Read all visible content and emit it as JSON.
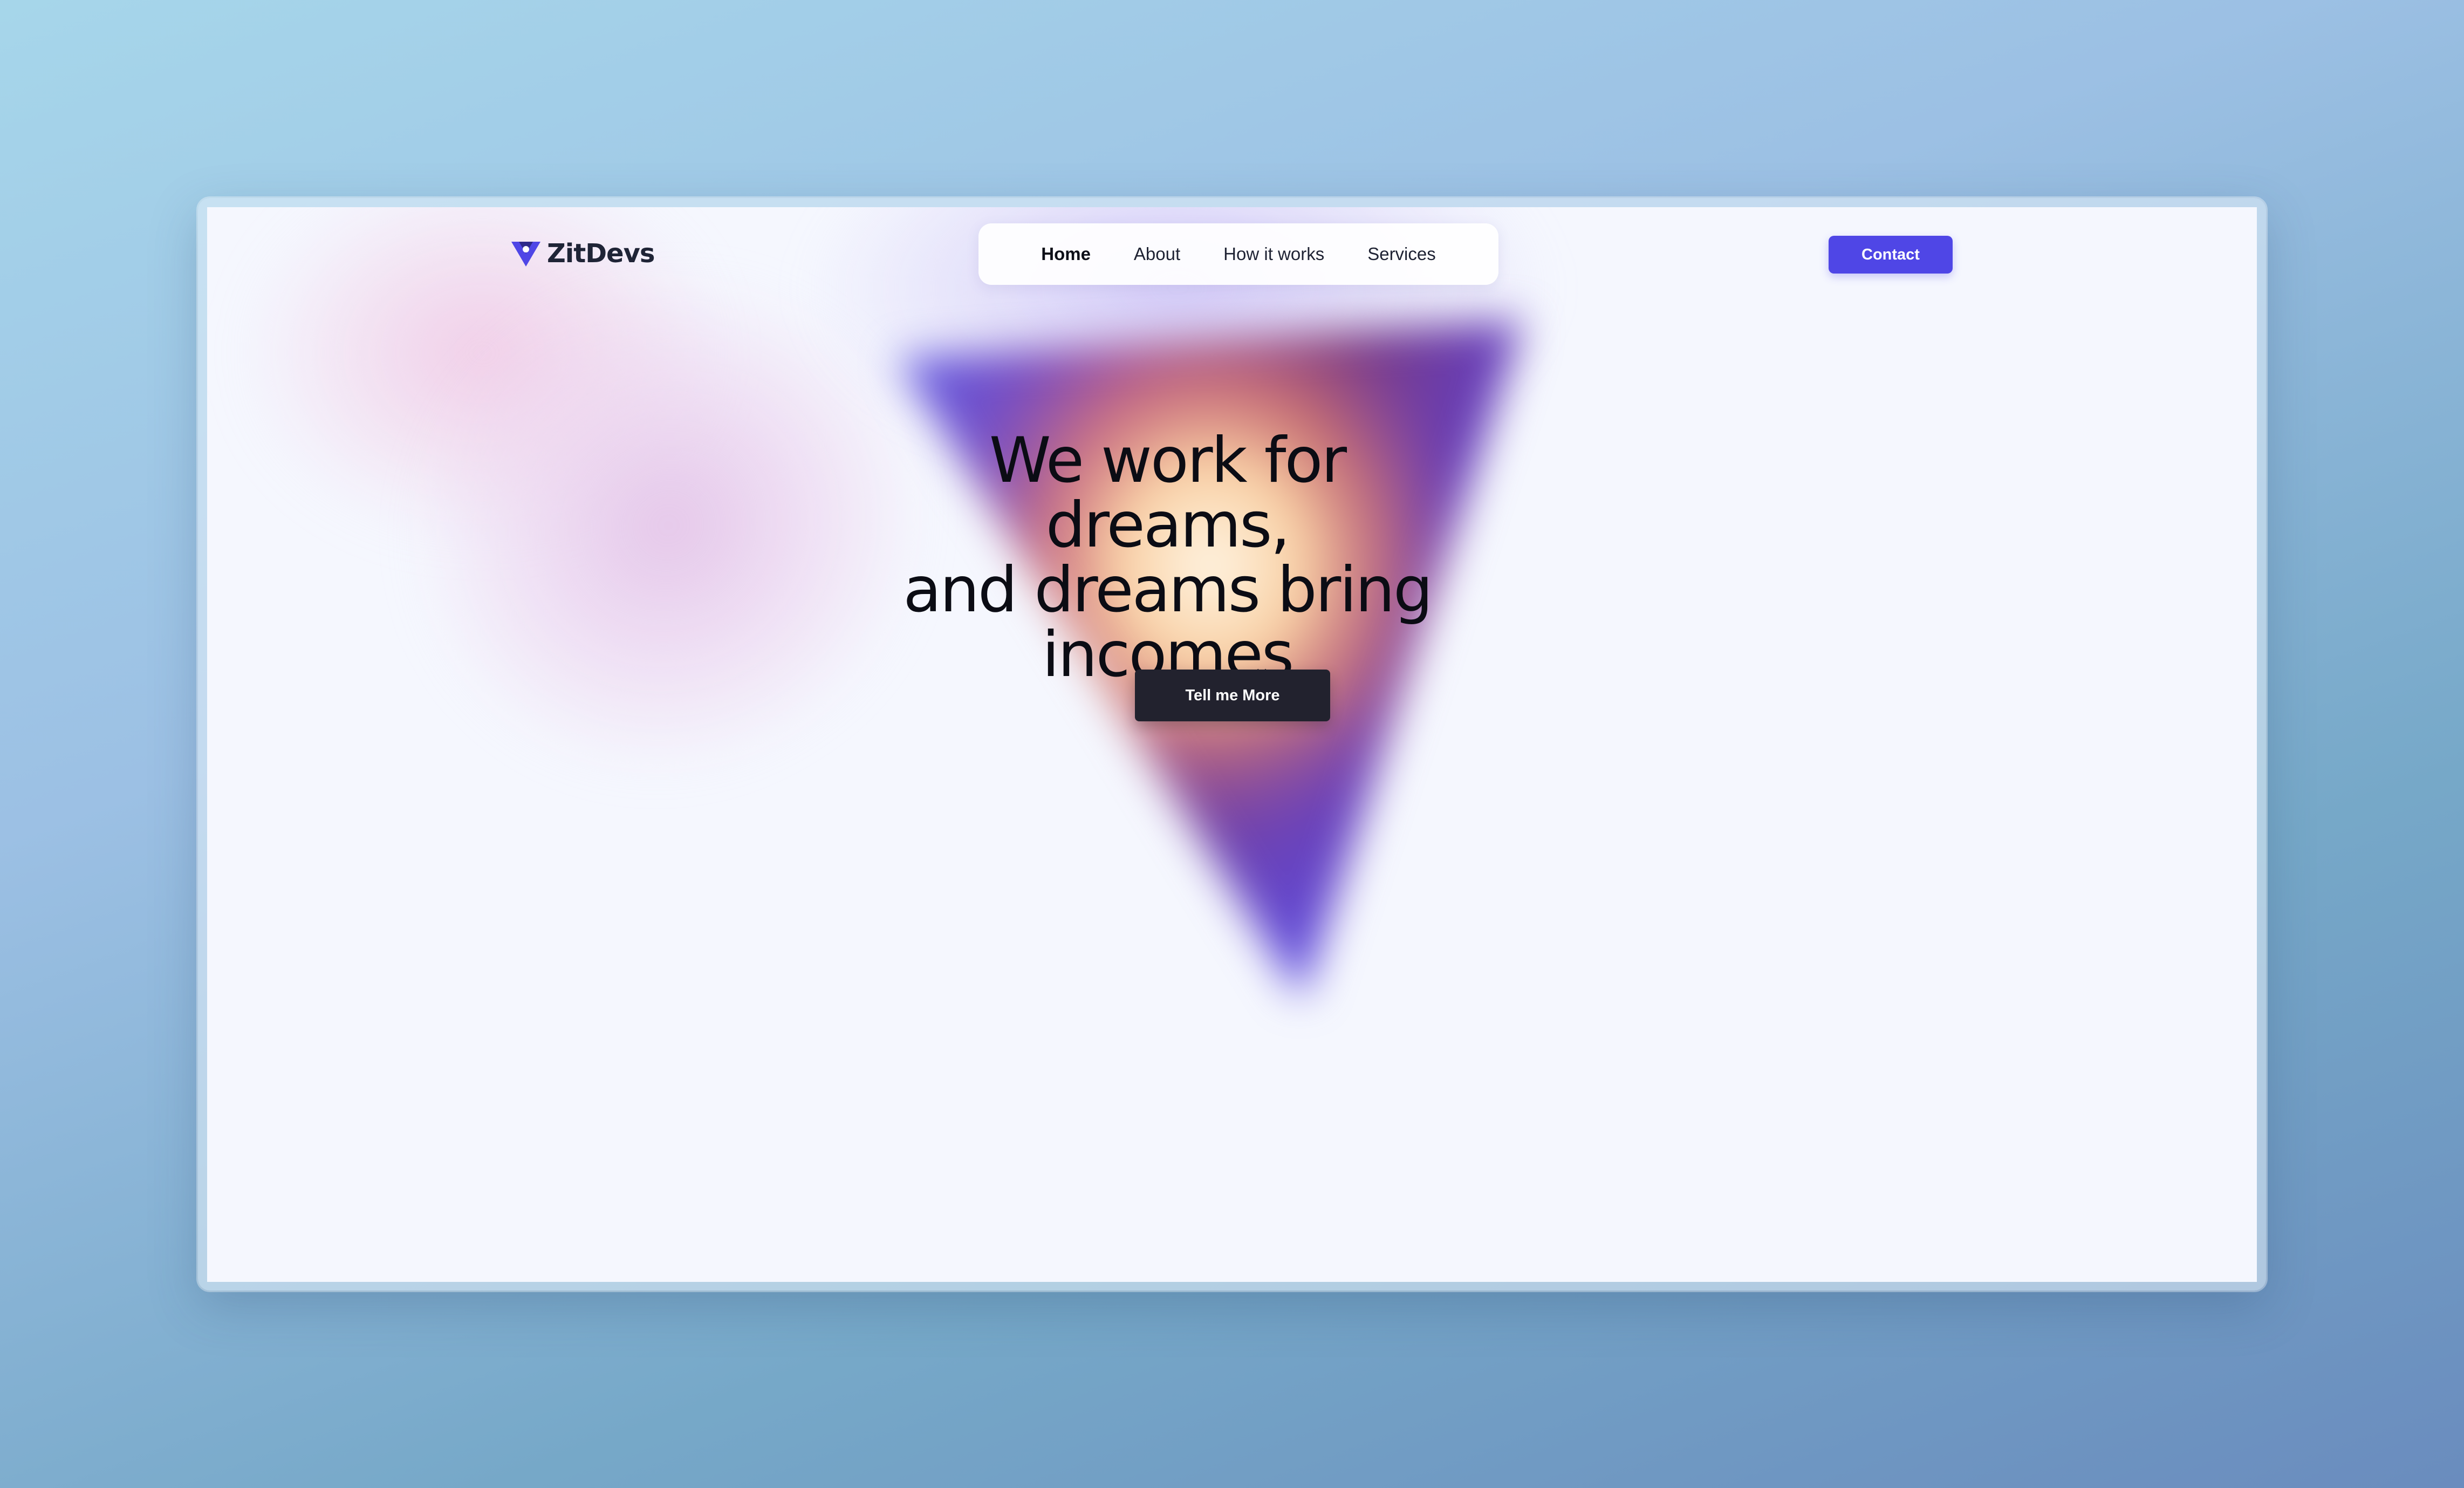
{
  "brand": {
    "name": "ZitDevs",
    "logo_icon": "triangle-logo-icon",
    "accent_color": "#4f46e6"
  },
  "nav": {
    "items": [
      {
        "label": "Home",
        "active": true
      },
      {
        "label": "About",
        "active": false
      },
      {
        "label": "How it works",
        "active": false
      },
      {
        "label": "Services",
        "active": false
      }
    ],
    "contact_label": "Contact"
  },
  "hero": {
    "title_lines": [
      "We work for dreams,",
      "and dreams bring",
      "incomes"
    ],
    "cta_label": "Tell me More"
  },
  "colors": {
    "page_background": "#f5f7fe",
    "cta_background": "#22222e",
    "contact_background": "#4f46e6"
  }
}
